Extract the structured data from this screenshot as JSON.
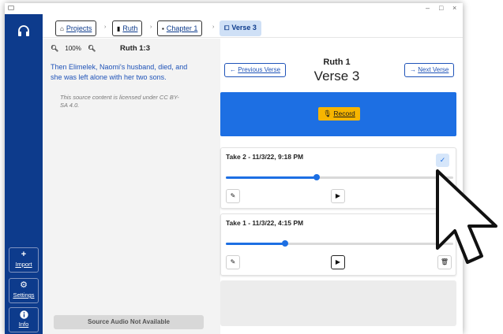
{
  "window": {
    "controls": {
      "minimize": "–",
      "maximize": "□",
      "close": "×"
    }
  },
  "sidebar": {
    "logo_icon": "headphones-icon",
    "buttons": [
      {
        "icon": "+",
        "label": "Import"
      },
      {
        "icon": "⚙",
        "label": "Settings"
      },
      {
        "icon": "i",
        "label": "Info"
      }
    ]
  },
  "breadcrumb": {
    "items": [
      {
        "icon": "home-icon",
        "label": "Projects"
      },
      {
        "icon": "book-icon",
        "label": "Ruth"
      },
      {
        "icon": "file-icon",
        "label": "Chapter 1"
      }
    ],
    "current": {
      "icon": "bookmark-icon",
      "label": "Verse 3"
    }
  },
  "source": {
    "zoom_level": "100%",
    "reference": "Ruth 1:3",
    "text": "Then Elimelek, Naomi's husband, died, and she was left alone with her two sons.",
    "license": "This source content is licensed under CC BY-SA 4.0.",
    "audio_status": "Source Audio Not Available"
  },
  "verse": {
    "book": "Ruth 1",
    "number": "Verse 3",
    "prev_label": "Previous Verse",
    "next_label": "Next Verse"
  },
  "record": {
    "label": "Record"
  },
  "takes": [
    {
      "title": "Take 2 - 11/3/22, 9:18 PM",
      "progress": 0.4,
      "status": "selected-check"
    },
    {
      "title": "Take 1 - 11/3/22, 4:15 PM",
      "progress": 0.26,
      "status": "upload"
    }
  ],
  "colors": {
    "sidebar": "#0d3b8c",
    "accent": "#1d6fe3",
    "record_button": "#f7b500",
    "link": "#1f53b8"
  }
}
